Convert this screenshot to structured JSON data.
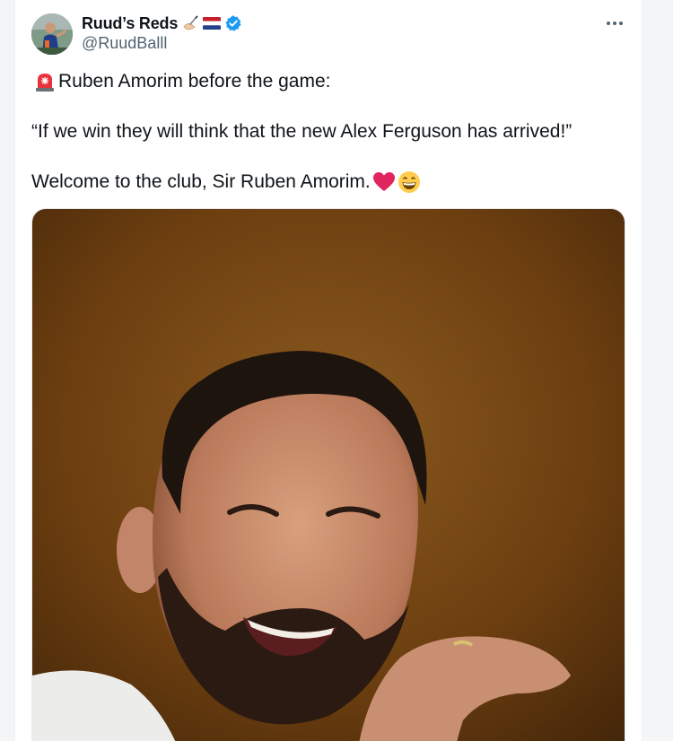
{
  "tweet": {
    "author": {
      "display_name": "Ruud’s Reds",
      "handle": "@RuudBalll",
      "badges": [
        "writing-hand-icon",
        "netherlands-flag-icon",
        "verified-badge-icon"
      ]
    },
    "text_line_1": "Ruben Amorim before the game:",
    "text_line_2": "“If we win they will think that the new Alex Ferguson has arrived!”",
    "text_line_3": "Welcome to the club, Sir Ruben Amorim.",
    "emojis": [
      "rotating-light-icon",
      "red-heart-icon",
      "grinning-face-icon"
    ],
    "media": {
      "type": "photo"
    }
  },
  "colors": {
    "text_primary": "#0f1419",
    "text_secondary": "#536471",
    "verified_blue": "#1d9bf0",
    "photo_background": "#7a4a14"
  }
}
